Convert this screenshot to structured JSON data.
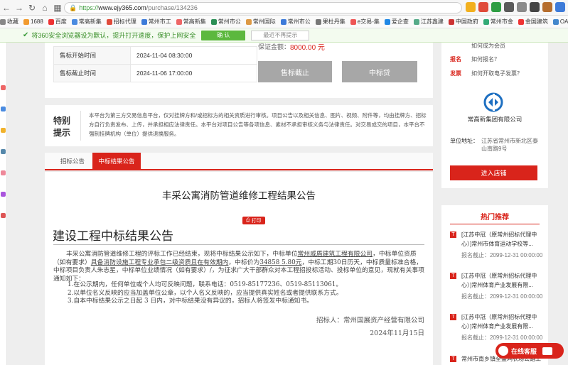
{
  "browser": {
    "url_protocol": "https://",
    "url_host": "www.ejy365.com",
    "url_path": "/purchase/134236",
    "bookmarks": [
      "收藏",
      "1688",
      "百度",
      "常高新集",
      "招标代理",
      "常州市工",
      "常高新集",
      "常州市公",
      "常州国际",
      "常州市公",
      "果杜丹集",
      "e交易-集",
      "爱企查",
      "江苏鑫建",
      "中国政府",
      "常州市金",
      "金国建筑",
      "OA系统"
    ]
  },
  "notice": {
    "text": "将360安全浏览器设为默认，提升打开速度，保护上网安全",
    "confirm": "确 认",
    "dismiss": "最近不再提示"
  },
  "sale_info": {
    "price_label": "保证金额：",
    "price_value": "8000.00 元",
    "rows": [
      {
        "label": "售标开始时间",
        "value": "2024-11-04 08:30:00"
      },
      {
        "label": "售标截止时间",
        "value": "2024-11-06 17:00:00"
      }
    ],
    "btn_closed": "售标截止",
    "btn_winning": "中标贷"
  },
  "special": {
    "title_line1": "特别",
    "title_line2": "提示",
    "text": "本平台为第三方交易信息平台，仅对挂牌方和/或招标方的相关资质进行审核。项目公告以及相关信息、图片、视频、附件等，均由挂牌方、招标方自行负责发布、上传，并承担相应法律责任。本平台对项目公告等各项信息、素材不承担审核义务与法律责任。对交易成交的项目，本平台不强制挂牌机构（单位）提供退换服务。"
  },
  "tabs": [
    "招标公告",
    "中标结果公告"
  ],
  "announcement": {
    "title": "丰采公寓消防管道维修工程结果公告",
    "print": "打印",
    "heading": "建设工程中标结果公告",
    "p1_prefix": "丰采公寓消防管道维修工程的评标工作已经结束，现将中标结果公示如下，中标单位",
    "winner": "常州威盾建筑工程有限公司",
    "p1_mid": "，中标单位资质（如有要求）",
    "qual": "具备消防设施工程专业承包二级资质且在有效期内",
    "p1_mid2": "，中标价为",
    "price": "34858 5.80元",
    "p1_suffix": "，中标工期30日历天，中标质量标准合格，中标项目负责人朱志星，中标单位业绩情况（如有要求）/，为征求广大干部群众对本工程招投标活动、投标单位的意见，现就有关事项通知如下：",
    "items": [
      "1.在公示期内，任何单位或个人均可反映问题，联系电话：0519-85177236、0519-85113061。",
      "2.以单位名义反映的应当加盖单位公章，以个人名义反映的，应当提供真实姓名或者提供联系方式。",
      "3.自本中标结果公示之日起 3 日内，对中标结果没有异议的，招标人将签发中标通知书。"
    ],
    "signer": "招标人：常州国展资产经营有限公司",
    "date": "2024年11月15日"
  },
  "right": {
    "rows": [
      {
        "tag": "报名",
        "text": "如何报名？"
      },
      {
        "tag": "发票",
        "text": "如何开取电子发票？"
      }
    ],
    "top_link": "如何成为会员",
    "company": "常高新集团有限公司",
    "addr_label": "单位地址：",
    "addr_value": "江苏省常州市新北区泰山南路9号",
    "enter_btn": "进入店铺",
    "hot_title": "热门推荐",
    "hot": [
      {
        "title": "[江苏中冠（原常州招标代理中心）]常州市体育运动学校等...",
        "date": "报名截止：2099-12-31 00:00:00"
      },
      {
        "title": "[江苏中冠（原常州招标代理中心）]常州体育产业发展有限...",
        "date": "报名截止：2099-12-31 00:00:00"
      },
      {
        "title": "[江苏中冠（原常州招标代理中心）]常州体育产业发展有限...",
        "date": "报名截止：2099-12-31 00:00:00"
      },
      {
        "title": "常州市南乡镇全盛鸡农场公路工",
        "date": ""
      }
    ],
    "service": "在线客服"
  },
  "colors": {
    "accent": "#d9241b",
    "green": "#5cb83e",
    "brand_blue": "#1d6fc1"
  }
}
